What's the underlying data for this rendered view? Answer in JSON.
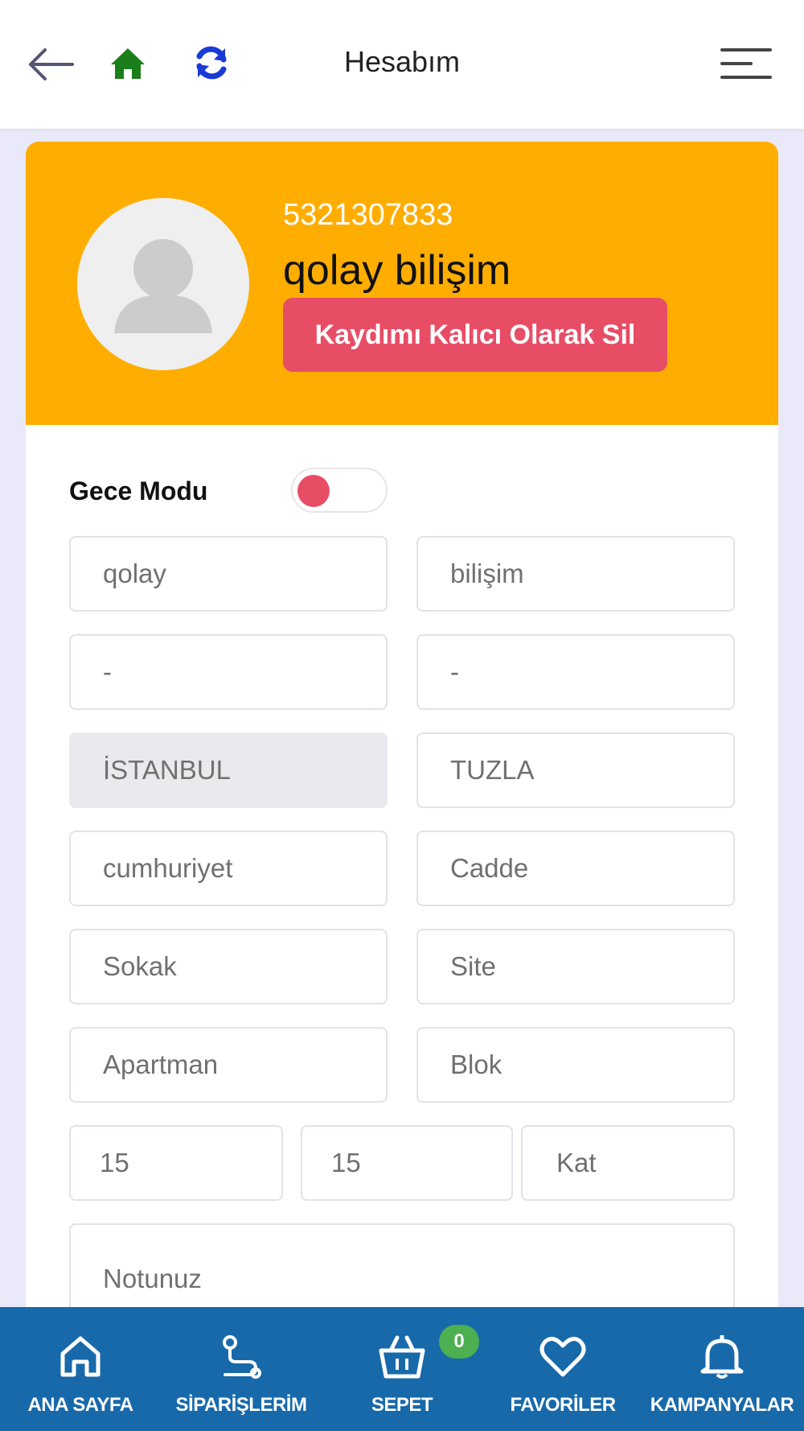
{
  "header": {
    "title": "Hesabım",
    "icons": {
      "back": "arrow-left-icon",
      "home": "home-icon",
      "refresh": "refresh-icon",
      "menu": "hamburger-menu-icon"
    },
    "colors": {
      "home": "#1a7f1a",
      "refresh": "#1a3ad6",
      "back": "#555577"
    }
  },
  "profile": {
    "phone": "5321307833",
    "name": "qolay bilişim",
    "delete_label": "Kaydımı Kalıcı Olarak Sil",
    "avatar_icon": "user-placeholder-icon",
    "header_color": "#ffad00",
    "delete_color": "#e84d66"
  },
  "settings": {
    "night_mode_label": "Gece Modu",
    "night_mode_on": false
  },
  "form": {
    "first_name": "qolay",
    "last_name": "bilişim",
    "field3": "-",
    "field4": "-",
    "city": "İSTANBUL",
    "district": "TUZLA",
    "neighborhood": "cumhuriyet",
    "street_placeholder": "Cadde",
    "lane_placeholder": "Sokak",
    "site_placeholder": "Site",
    "apartment_placeholder": "Apartman",
    "block_placeholder": "Blok",
    "building_no": "15",
    "door_no": "15",
    "floor_placeholder": "Kat",
    "note_placeholder": "Notunuz"
  },
  "bottom_nav": {
    "items": [
      {
        "label": "ANA SAYFA",
        "icon": "home-outline-icon"
      },
      {
        "label": "SİPARİŞLERİM",
        "icon": "route-icon"
      },
      {
        "label": "SEPET",
        "icon": "basket-icon"
      },
      {
        "label": "FAVORİLER",
        "icon": "heart-icon"
      },
      {
        "label": "KAMPANYALAR",
        "icon": "bell-icon"
      }
    ],
    "cart_count": "0",
    "background": "#1769aa",
    "badge_color": "#4caf50"
  }
}
